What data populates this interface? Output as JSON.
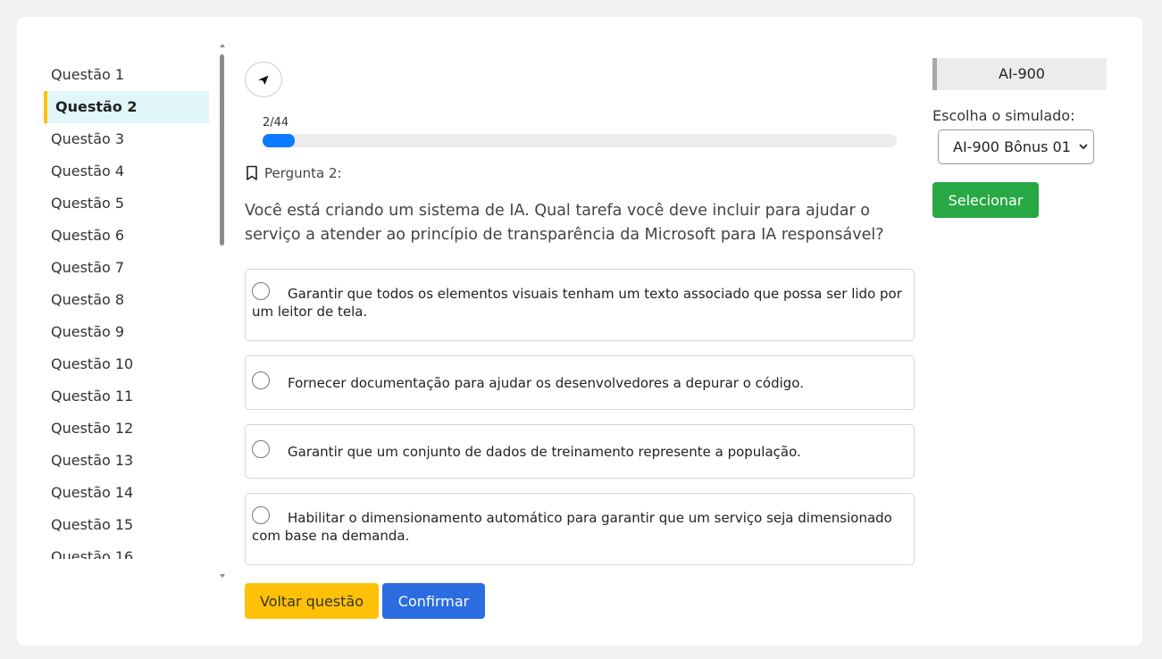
{
  "sidebar": {
    "items": [
      {
        "label": "Questão 1"
      },
      {
        "label": "Questão 2",
        "active": true
      },
      {
        "label": "Questão 3"
      },
      {
        "label": "Questão 4"
      },
      {
        "label": "Questão 5"
      },
      {
        "label": "Questão 6"
      },
      {
        "label": "Questão 7"
      },
      {
        "label": "Questão 8"
      },
      {
        "label": "Questão 9"
      },
      {
        "label": "Questão 10"
      },
      {
        "label": "Questão 11"
      },
      {
        "label": "Questão 12"
      },
      {
        "label": "Questão 13"
      },
      {
        "label": "Questão 14"
      },
      {
        "label": "Questão 15"
      },
      {
        "label": "Questão 16"
      }
    ]
  },
  "main": {
    "back_icon": "arrow-left-icon",
    "progress": {
      "label": "2/44",
      "fraction": 0.05
    },
    "pergunta_label": "Pergunta 2:",
    "pergunta_icon": "bookmark-icon",
    "question_text": "Você está criando um sistema de IA. Qual tarefa você deve incluir para ajudar o serviço a atender ao princípio de transparência da Microsoft para IA responsável?",
    "options": [
      {
        "text": "Garantir que todos os elementos visuais tenham um texto associado que possa ser lido por um leitor de tela."
      },
      {
        "text": "Fornecer documentação para ajudar os desenvolvedores a depurar o código."
      },
      {
        "text": "Garantir que um conjunto de dados de treinamento represente a população."
      },
      {
        "text": "Habilitar o dimensionamento automático para garantir que um serviço seja dimensionado com base na demanda."
      }
    ],
    "back_question_label": "Voltar questão",
    "confirm_label": "Confirmar"
  },
  "right": {
    "exam_code": "AI-900",
    "choose_label": "Escolha o simulado:",
    "select_value": "AI-900 Bônus 01",
    "select_button": "Selecionar"
  },
  "colors": {
    "accent_yellow": "#ffc107",
    "primary_blue": "#2b6de0",
    "success_green": "#28a745",
    "progress_blue": "#0d7bff",
    "active_bg": "#e0f6f8"
  }
}
